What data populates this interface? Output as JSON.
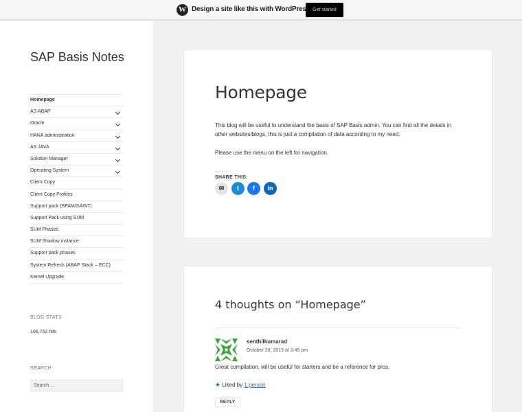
{
  "topbar": {
    "logo_glyph": "W",
    "promo_text": "Design a site like this with WordPress.com",
    "cta_label": "Get started"
  },
  "sidebar": {
    "site_title": "SAP Basis Notes",
    "menu": [
      {
        "label": "Homepage",
        "current": true,
        "has_submenu": false
      },
      {
        "label": "AS ABAP",
        "has_submenu": true
      },
      {
        "label": "Oracle",
        "has_submenu": true
      },
      {
        "label": "HANA administration",
        "has_submenu": true
      },
      {
        "label": "AS JAVA",
        "has_submenu": true
      },
      {
        "label": "Solution Manager",
        "has_submenu": true
      },
      {
        "label": "Operating System",
        "has_submenu": true
      },
      {
        "label": "Client Copy",
        "has_submenu": false
      },
      {
        "label": "Client Copy Profiles",
        "has_submenu": false
      },
      {
        "label": "Support pack (SPAM/SAINT)",
        "has_submenu": false
      },
      {
        "label": "Support Pack using SUM",
        "has_submenu": false
      },
      {
        "label": "SUM Phases",
        "has_submenu": false
      },
      {
        "label": "SUM Shadow instance",
        "has_submenu": false
      },
      {
        "label": "Support pack phases",
        "has_submenu": false
      },
      {
        "label": "System Refresh (ABAP Stack – ECC)",
        "has_submenu": false
      },
      {
        "label": "Kernel Upgrade",
        "has_submenu": false
      }
    ],
    "blog_stats": {
      "title": "BLOG STATS",
      "value": "106,752 hits"
    },
    "search": {
      "title": "SEARCH",
      "placeholder": "Search …"
    }
  },
  "post": {
    "title": "Homepage",
    "paragraphs": [
      "This blog will be useful to understand the basis of SAP Basis admin. You can find all the details in other websites/blogs, this is just a compilation of data according to my need.",
      "Please use the menu on the left for navigation."
    ],
    "share": {
      "title": "SHARE THIS:",
      "buttons": [
        {
          "icon": "email-icon",
          "glyph": "✉"
        },
        {
          "icon": "twitter-icon",
          "glyph": "t"
        },
        {
          "icon": "facebook-icon",
          "glyph": "f"
        },
        {
          "icon": "linkedin-icon",
          "glyph": "in"
        }
      ]
    }
  },
  "comments": {
    "title": "4 thoughts on “Homepage”",
    "items": [
      {
        "author": "senthilkumarad",
        "date": "October 28, 2015 at 2:45 pm",
        "text": "Great compilation, will be useful for starters and be a reference for pros.",
        "liked_by_prefix": "Liked by",
        "liked_by_link": "1 person",
        "reply_label": "REPLY"
      }
    ]
  },
  "colors": {
    "background": "#f1f1f1",
    "accent_link": "#2271b1",
    "twitter": "#1a8cd8",
    "facebook": "#1877f2",
    "linkedin": "#0a66c2",
    "avatar_green": "#3aa53a"
  }
}
